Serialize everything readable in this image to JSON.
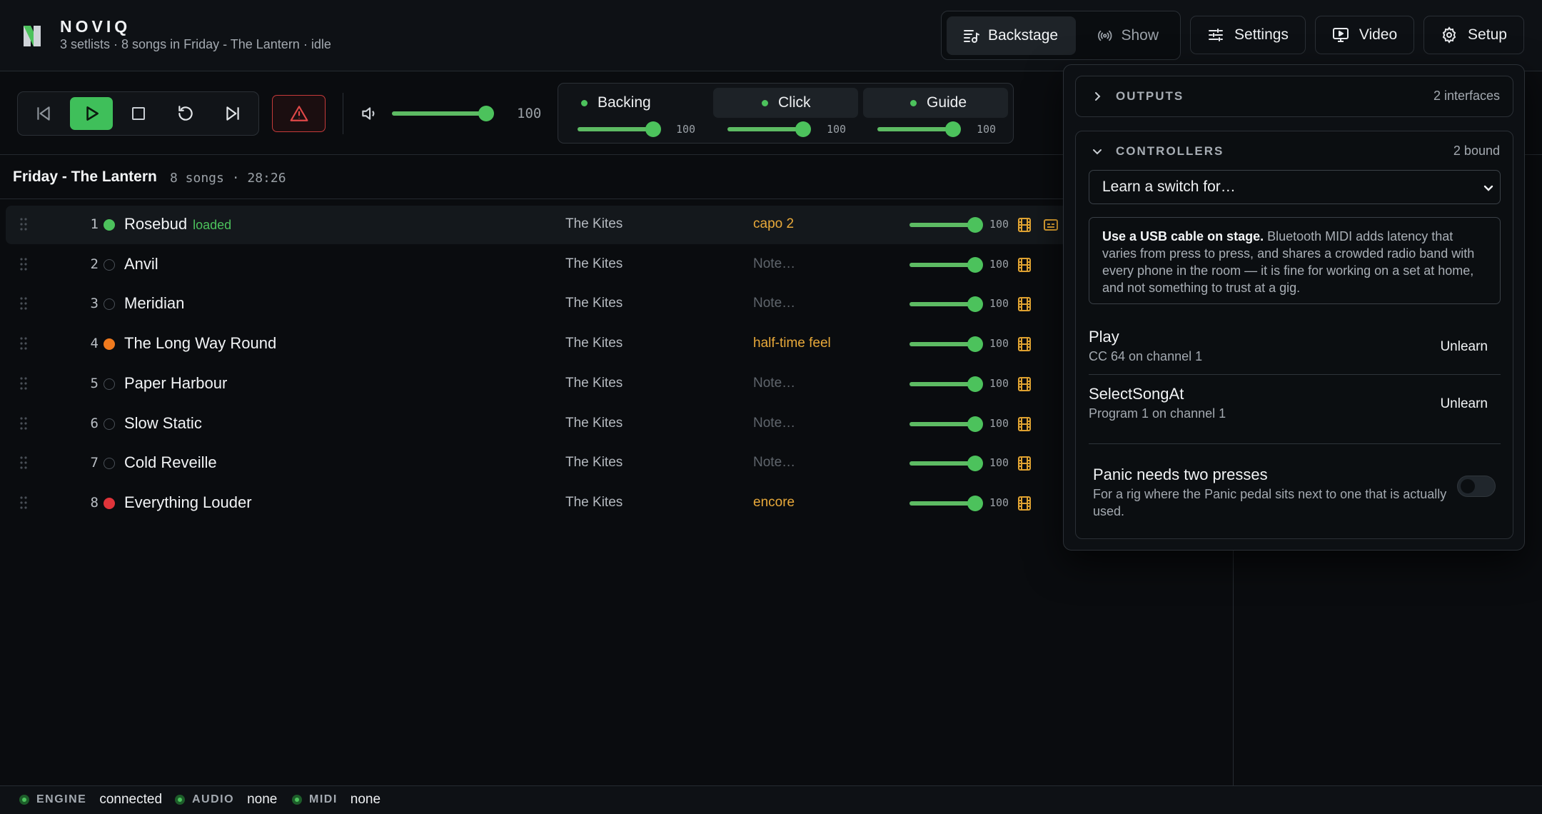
{
  "app": {
    "name": "NOVIQ",
    "subtitle": "3 setlists · 8 songs in Friday - The Lantern · idle"
  },
  "header": {
    "modes": [
      {
        "label": "Backstage",
        "icon": "setlist-music-icon",
        "active": true
      },
      {
        "label": "Show",
        "icon": "broadcast-icon",
        "active": false
      }
    ],
    "buttons": [
      {
        "label": "Settings",
        "icon": "sliders-icon"
      },
      {
        "label": "Video",
        "icon": "monitor-play-icon"
      },
      {
        "label": "Setup",
        "icon": "gear-icon"
      }
    ]
  },
  "transport": {
    "buttons": [
      "skip-back-icon",
      "play-icon",
      "stop-icon",
      "restart-icon",
      "skip-forward-icon"
    ],
    "panic_icon": "warning-triangle-icon",
    "master_volume": 100,
    "master_volume_label": "100"
  },
  "mixer": [
    {
      "name": "Backing",
      "value": 100,
      "value_label": "100",
      "selected": false
    },
    {
      "name": "Click",
      "value": 100,
      "value_label": "100",
      "selected": true
    },
    {
      "name": "Guide",
      "value": 100,
      "value_label": "100",
      "selected": true
    }
  ],
  "setlist": {
    "title": "Friday - The Lantern",
    "meta": "8 songs · 28:26",
    "songs": [
      {
        "num": "1",
        "title": "Rosebud",
        "tag": "loaded",
        "status": "green",
        "artist": "The Kites",
        "note": "capo 2",
        "note_is_placeholder": false,
        "volume": 100,
        "volume_label": "100",
        "extra_icon": "lyrics-icon"
      },
      {
        "num": "2",
        "title": "Anvil",
        "tag": "",
        "status": "empty",
        "artist": "The Kites",
        "note": "Note…",
        "note_is_placeholder": true,
        "volume": 100,
        "volume_label": "100"
      },
      {
        "num": "3",
        "title": "Meridian",
        "tag": "",
        "status": "empty",
        "artist": "The Kites",
        "note": "Note…",
        "note_is_placeholder": true,
        "volume": 100,
        "volume_label": "100"
      },
      {
        "num": "4",
        "title": "The Long Way Round",
        "tag": "",
        "status": "orange",
        "artist": "The Kites",
        "note": "half-time feel",
        "note_is_placeholder": false,
        "volume": 100,
        "volume_label": "100"
      },
      {
        "num": "5",
        "title": "Paper Harbour",
        "tag": "",
        "status": "empty",
        "artist": "The Kites",
        "note": "Note…",
        "note_is_placeholder": true,
        "volume": 100,
        "volume_label": "100"
      },
      {
        "num": "6",
        "title": "Slow Static",
        "tag": "",
        "status": "empty",
        "artist": "The Kites",
        "note": "Note…",
        "note_is_placeholder": true,
        "volume": 100,
        "volume_label": "100"
      },
      {
        "num": "7",
        "title": "Cold Reveille",
        "tag": "",
        "status": "empty",
        "artist": "The Kites",
        "note": "Note…",
        "note_is_placeholder": true,
        "volume": 100,
        "volume_label": "100"
      },
      {
        "num": "8",
        "title": "Everything Louder",
        "tag": "",
        "status": "red",
        "artist": "The Kites",
        "note": "encore",
        "note_is_placeholder": false,
        "volume": 100,
        "volume_label": "100"
      }
    ]
  },
  "setup_popover": {
    "outputs": {
      "title": "OUTPUTS",
      "meta": "2 interfaces"
    },
    "controllers": {
      "title": "CONTROLLERS",
      "meta": "2 bound",
      "learn_select": "Learn a switch for…",
      "callout_bold": "Use a USB cable on stage.",
      "callout_text": " Bluetooth MIDI adds latency that varies from press to press, and shares a crowded radio band with every phone in the room — it is fine for working on a set at home, and not something to trust at a gig.",
      "bindings": [
        {
          "name": "Play",
          "desc": "CC 64 on channel 1",
          "action": "Unlearn"
        },
        {
          "name": "SelectSongAt",
          "desc": "Program 1 on channel 1",
          "action": "Unlearn"
        }
      ],
      "option": {
        "title": "Panic needs two presses",
        "desc": "For a rig where the Panic pedal sits next to one that is actually used.",
        "enabled": false
      }
    }
  },
  "status_bar": [
    {
      "label": "ENGINE",
      "value": "connected"
    },
    {
      "label": "AUDIO",
      "value": "none"
    },
    {
      "label": "MIDI",
      "value": "none"
    }
  ],
  "colors": {
    "accent": "#4cc25c",
    "note": "#e8a93a",
    "status_orange": "#f07a1e",
    "status_red": "#e0343a",
    "panic": "#c53a3a"
  }
}
